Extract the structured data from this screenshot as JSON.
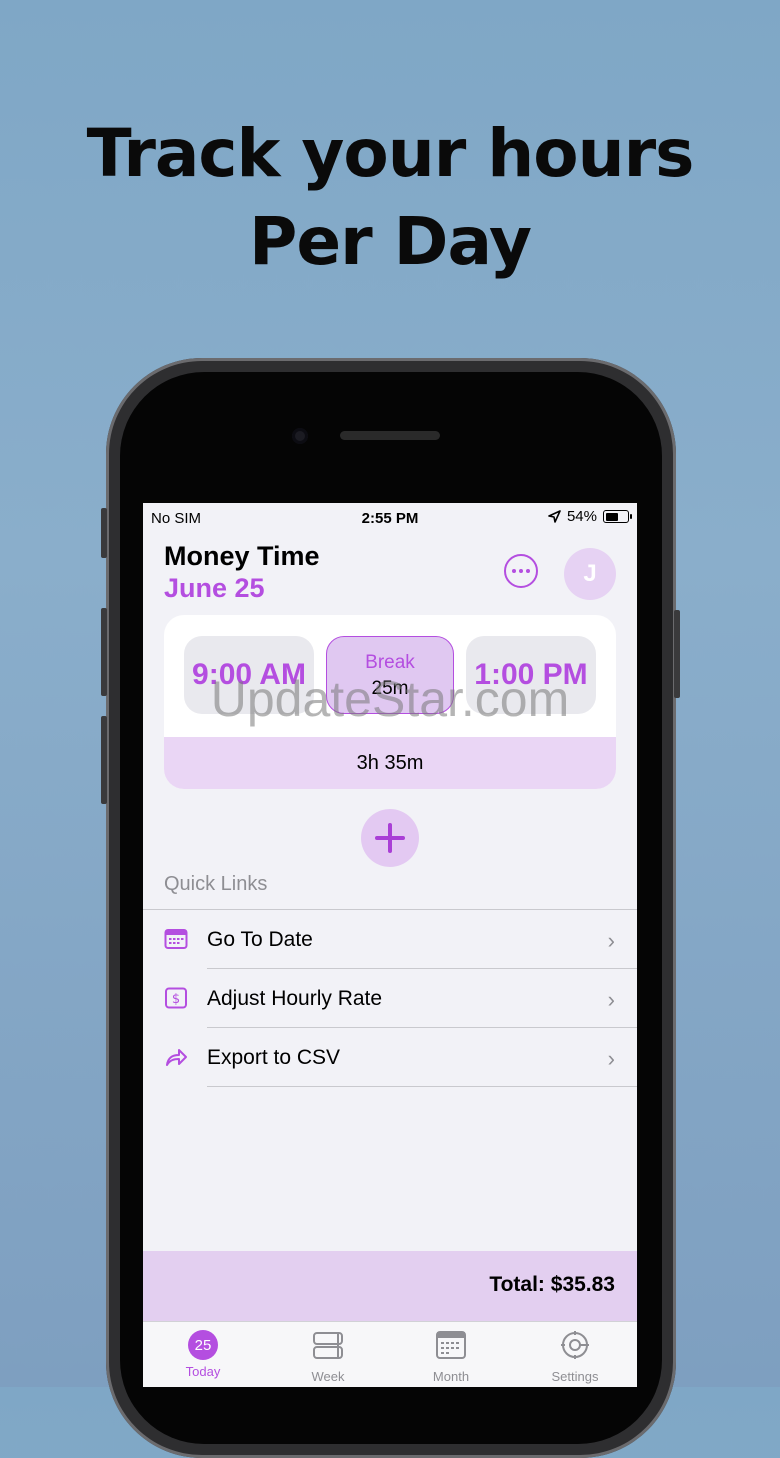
{
  "headline": {
    "line1": "Track your hours",
    "line2": "Per Day"
  },
  "status_bar": {
    "carrier": "No SIM",
    "time": "2:55 PM",
    "battery": "54%",
    "battery_level": 0.54
  },
  "header": {
    "title": "Money Time",
    "date": "June 25",
    "avatar_initial": "J"
  },
  "entry": {
    "start": "9:00 AM",
    "break_label": "Break",
    "break_value": "25m",
    "end": "1:00 PM",
    "duration": "3h 35m"
  },
  "watermark": "UpdateStar.com",
  "quick_links": {
    "title": "Quick Links",
    "items": [
      {
        "label": "Go To Date",
        "icon": "calendar-icon"
      },
      {
        "label": "Adjust Hourly Rate",
        "icon": "dollar-icon"
      },
      {
        "label": "Export to CSV",
        "icon": "share-arrow-icon"
      }
    ]
  },
  "total": "Total: $35.83",
  "tabs": [
    {
      "label": "Today",
      "badge": "25",
      "icon": "today-badge-icon",
      "active": true
    },
    {
      "label": "Week",
      "icon": "week-icon"
    },
    {
      "label": "Month",
      "icon": "month-calendar-icon"
    },
    {
      "label": "Settings",
      "icon": "gear-icon"
    }
  ],
  "colors": {
    "accent": "#b44ee0",
    "accent_light": "#e3cff0",
    "background": "#f2f2f7"
  }
}
